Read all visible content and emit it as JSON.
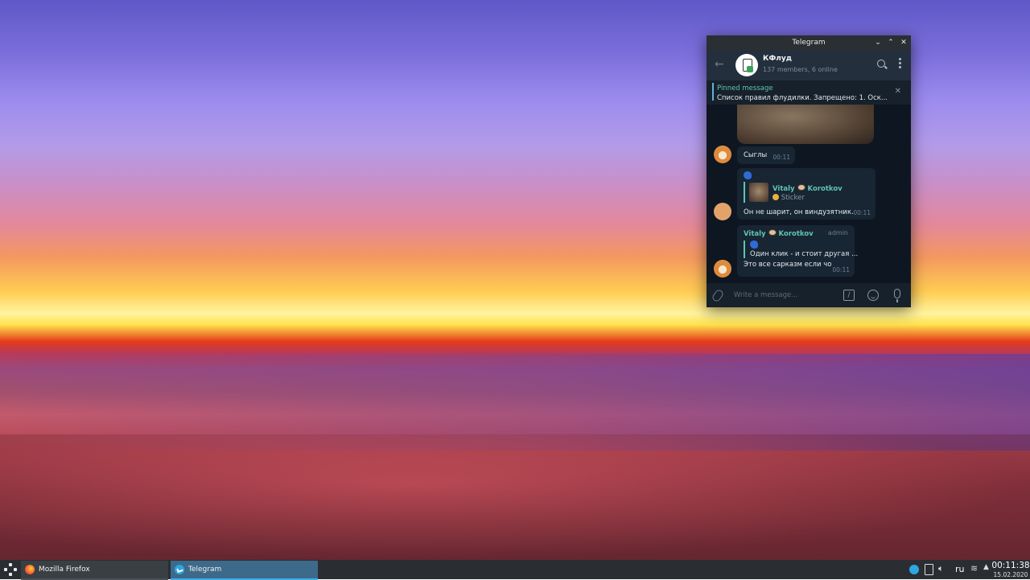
{
  "window": {
    "title": "Telegram",
    "controls": [
      "minimize",
      "maximize",
      "close"
    ]
  },
  "chat": {
    "name": "КФлуд",
    "subtitle": "137 members, 6 online"
  },
  "pinned": {
    "title": "Pinned message",
    "text": "Список правил флудилки.  Запрещено: 1. Оск..."
  },
  "messages": [
    {
      "text": "Сыглы",
      "time": "00:11"
    },
    {
      "reply_sender_first": "Vitaly",
      "reply_sender_last": "Korotkov",
      "reply_preview": "Sticker",
      "text": "Он не шарит, он виндузятник.",
      "time": "00:11"
    },
    {
      "sender_first": "Vitaly",
      "sender_last": "Korotkov",
      "badge": "admin",
      "reply_preview": "Один клик - и стоит другая ...",
      "text": "Это все сарказм если чо",
      "time": "00:11"
    }
  ],
  "composer": {
    "placeholder": "Write a message..."
  },
  "taskbar": {
    "tasks": [
      {
        "label": "Mozilla Firefox",
        "active": false
      },
      {
        "label": "Telegram",
        "active": true
      }
    ],
    "tray": {
      "language": "ru",
      "time": "00:11:38",
      "date": "15.02.2020"
    }
  },
  "colors": {
    "accent": "#5ec5b0",
    "taskbar_active": "#3daee9",
    "window_bg": "#17212b"
  }
}
